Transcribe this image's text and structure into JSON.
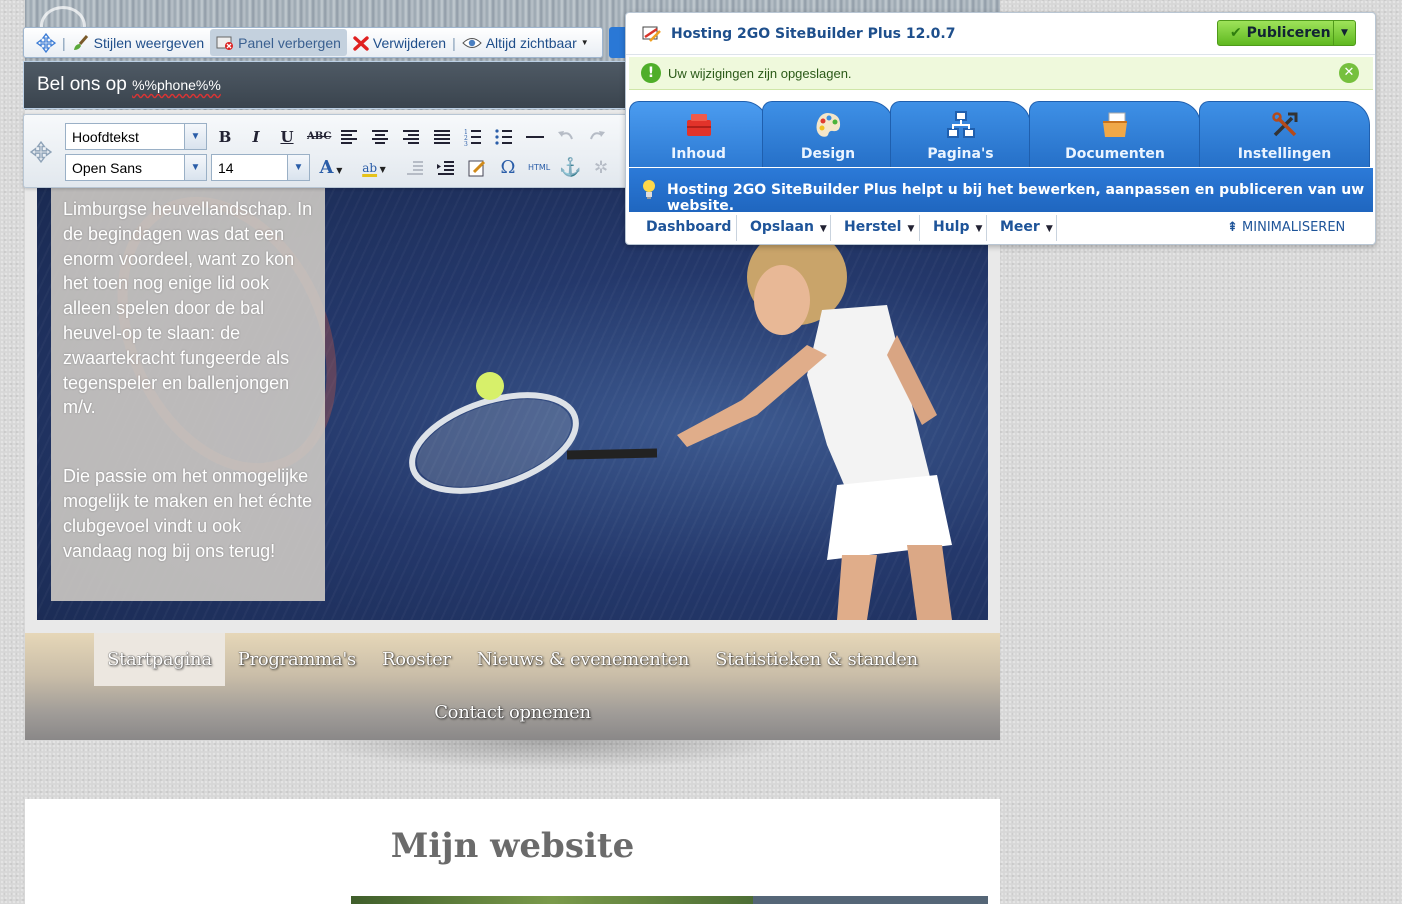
{
  "site": {
    "phone_prefix": "Bel ons op",
    "phone_value": "%%phone%%",
    "side_text_1": "Limburgse heuvellandschap. In de begindagen was dat een enorm voordeel, want zo kon het toen nog enige lid ook alleen spelen door de bal heuvel-op te slaan: de zwaartekracht fungeerde als tegenspeler en ballenjongen m/v.",
    "side_text_2": "Die passie om het onmogelijke mogelijk te maken en het échte clubgevoel vindt u ook vandaag nog bij ons terug!",
    "nav": [
      {
        "label": "Startpagina",
        "active": true
      },
      {
        "label": "Programma's"
      },
      {
        "label": "Rooster"
      },
      {
        "label": "Nieuws & evenementen"
      },
      {
        "label": "Statistieken & standen"
      },
      {
        "label": "Contact opnemen"
      }
    ],
    "content_title": "Mijn website"
  },
  "top_toolbar": {
    "styles_label": "Stijlen weergeven",
    "hide_panel_label": "Panel verbergen",
    "delete_label": "Verwijderen",
    "visibility_label": "Altijd zichtbaar"
  },
  "format_toolbar": {
    "paragraph_style": "Hoofdtekst",
    "font_family": "Open Sans",
    "font_size": "14",
    "html_label": "HTML"
  },
  "sitebuilder": {
    "title": "Hosting 2GO SiteBuilder Plus 12.0.7",
    "publish_label": "Publiceren",
    "notice": "Uw wijzigingen zijn opgeslagen.",
    "tabs": [
      {
        "label": "Inhoud",
        "icon": "toolbox-icon"
      },
      {
        "label": "Design",
        "icon": "palette-icon"
      },
      {
        "label": "Pagina's",
        "icon": "sitemap-icon"
      },
      {
        "label": "Documenten",
        "icon": "documents-icon"
      },
      {
        "label": "Instellingen",
        "icon": "tools-icon"
      }
    ],
    "info": "Hosting 2GO SiteBuilder Plus helpt u bij het bewerken, aanpassen en publiceren van uw website.",
    "menu": {
      "dashboard": "Dashboard",
      "save": "Opslaan",
      "restore": "Herstel",
      "help": "Hulp",
      "more": "Meer",
      "minimize": "MINIMALISEREN"
    },
    "colors": {
      "accent": "#2a78d6",
      "publish": "#6cc52c",
      "notice_bg": "#eff9dc"
    }
  }
}
